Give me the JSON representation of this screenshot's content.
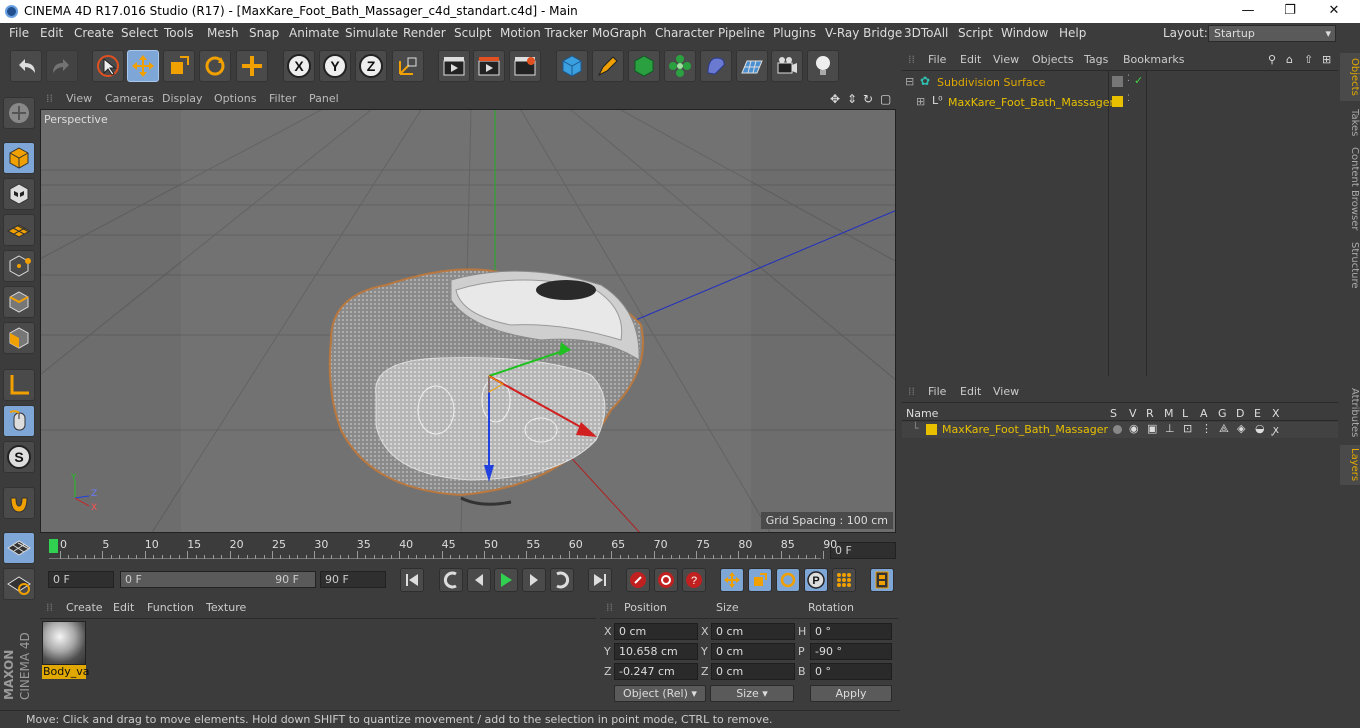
{
  "titlebar": {
    "title": "CINEMA 4D R17.016 Studio (R17) - [MaxKare_Foot_Bath_Massager_c4d_standart.c4d] - Main",
    "minimize": "—",
    "maximize": "❐",
    "close": "✕"
  },
  "menu": {
    "items": [
      "File",
      "Edit",
      "Create",
      "Select",
      "Tools",
      "Mesh",
      "Snap",
      "Animate",
      "Simulate",
      "Render",
      "Sculpt",
      "Motion Tracker",
      "MoGraph",
      "Character",
      "Pipeline",
      "Plugins",
      "V-Ray Bridge",
      "3DToAll",
      "Script",
      "Window",
      "Help"
    ],
    "layout_label": "Layout:",
    "layout_value": "Startup"
  },
  "viewport": {
    "menu": [
      "View",
      "Cameras",
      "Display",
      "Options",
      "Filter",
      "Panel"
    ],
    "label": "Perspective",
    "grid_spacing": "Grid Spacing : 100 cm"
  },
  "timeline": {
    "ticks": [
      "0",
      "5",
      "10",
      "15",
      "20",
      "25",
      "30",
      "35",
      "40",
      "45",
      "50",
      "55",
      "60",
      "65",
      "70",
      "75",
      "80",
      "85",
      "90"
    ],
    "current_frame": "0 F"
  },
  "playbar": {
    "start": "0 F",
    "range_start": "0 F",
    "range_end": "90 F",
    "end": "90 F"
  },
  "materials": {
    "menu": [
      "Create",
      "Edit",
      "Function",
      "Texture"
    ],
    "items": [
      {
        "name": "Body_va"
      }
    ]
  },
  "coords": {
    "headers": {
      "position": "Position",
      "size": "Size",
      "rotation": "Rotation"
    },
    "rows": [
      {
        "axis": "X",
        "pos": "0 cm",
        "saxis": "X",
        "size": "0 cm",
        "raxis": "H",
        "rot": "0 °"
      },
      {
        "axis": "Y",
        "pos": "10.658 cm",
        "saxis": "Y",
        "size": "0 cm",
        "raxis": "P",
        "rot": "-90 °"
      },
      {
        "axis": "Z",
        "pos": "-0.247 cm",
        "saxis": "Z",
        "size": "0 cm",
        "raxis": "B",
        "rot": "0 °"
      }
    ],
    "mode": "Object (Rel)",
    "size_mode": "Size",
    "apply": "Apply"
  },
  "status": "Move: Click and drag to move elements. Hold down SHIFT to quantize movement / add to the selection in point mode, CTRL to remove.",
  "objects": {
    "menu": [
      "File",
      "Edit",
      "View",
      "Objects",
      "Tags",
      "Bookmarks"
    ],
    "items": [
      {
        "name": "Subdivision Surface",
        "color": "#e0a800"
      },
      {
        "name": "MaxKare_Foot_Bath_Massager",
        "color": "#e8c000"
      }
    ]
  },
  "layers": {
    "menu": [
      "File",
      "Edit",
      "View"
    ],
    "name_header": "Name",
    "columns": [
      "S",
      "V",
      "R",
      "M",
      "L",
      "A",
      "G",
      "D",
      "E",
      "X"
    ],
    "items": [
      {
        "name": "MaxKare_Foot_Bath_Massager",
        "color": "#e8c000"
      }
    ]
  },
  "right_tabs": [
    "Objects",
    "Takes",
    "Content Browser",
    "Structure",
    "Attributes",
    "Layers"
  ],
  "branding": {
    "maxon": "MAXON",
    "cinema": "CINEMA 4D"
  },
  "colors": {
    "accent": "#e0a800",
    "selected_tool": "#7ea7d8",
    "axis_x": "#d02020",
    "axis_y": "#20c020",
    "axis_z": "#2040e0"
  }
}
